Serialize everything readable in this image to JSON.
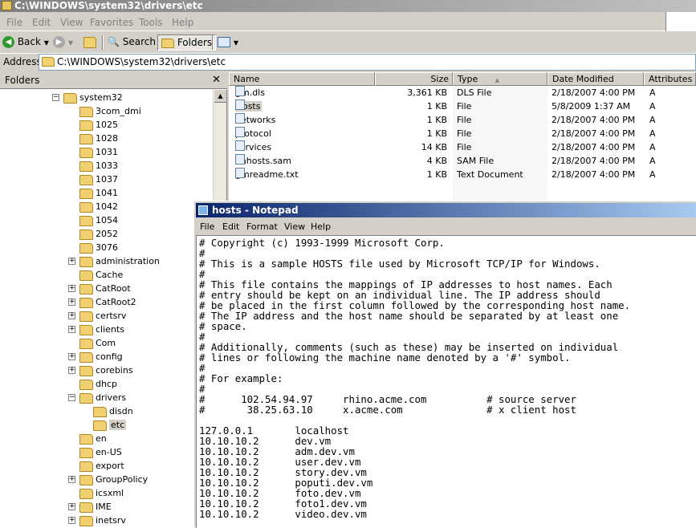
{
  "explorer": {
    "title": "C:\\WINDOWS\\system32\\drivers\\etc",
    "menu": [
      "File",
      "Edit",
      "View",
      "Favorites",
      "Tools",
      "Help"
    ],
    "toolbar": {
      "back": "Back",
      "search": "Search",
      "folders": "Folders"
    },
    "address_label": "Address",
    "address_value": "C:\\WINDOWS\\system32\\drivers\\etc"
  },
  "folders_pane": {
    "title": "Folders",
    "close": "✕",
    "tree": [
      {
        "label": "system32",
        "indent": 0,
        "toggle": "−"
      },
      {
        "label": "3com_dmi",
        "indent": 1,
        "toggle": ""
      },
      {
        "label": "1025",
        "indent": 1,
        "toggle": ""
      },
      {
        "label": "1028",
        "indent": 1,
        "toggle": ""
      },
      {
        "label": "1031",
        "indent": 1,
        "toggle": ""
      },
      {
        "label": "1033",
        "indent": 1,
        "toggle": ""
      },
      {
        "label": "1037",
        "indent": 1,
        "toggle": ""
      },
      {
        "label": "1041",
        "indent": 1,
        "toggle": ""
      },
      {
        "label": "1042",
        "indent": 1,
        "toggle": ""
      },
      {
        "label": "1054",
        "indent": 1,
        "toggle": ""
      },
      {
        "label": "2052",
        "indent": 1,
        "toggle": ""
      },
      {
        "label": "3076",
        "indent": 1,
        "toggle": ""
      },
      {
        "label": "administration",
        "indent": 1,
        "toggle": "+"
      },
      {
        "label": "Cache",
        "indent": 1,
        "toggle": ""
      },
      {
        "label": "CatRoot",
        "indent": 1,
        "toggle": "+"
      },
      {
        "label": "CatRoot2",
        "indent": 1,
        "toggle": "+"
      },
      {
        "label": "certsrv",
        "indent": 1,
        "toggle": "+"
      },
      {
        "label": "clients",
        "indent": 1,
        "toggle": "+"
      },
      {
        "label": "Com",
        "indent": 1,
        "toggle": ""
      },
      {
        "label": "config",
        "indent": 1,
        "toggle": "+"
      },
      {
        "label": "corebins",
        "indent": 1,
        "toggle": "+"
      },
      {
        "label": "dhcp",
        "indent": 1,
        "toggle": ""
      },
      {
        "label": "drivers",
        "indent": 1,
        "toggle": "−"
      },
      {
        "label": "disdn",
        "indent": 2,
        "toggle": ""
      },
      {
        "label": "etc",
        "indent": 2,
        "toggle": "",
        "selected": true
      },
      {
        "label": "en",
        "indent": 1,
        "toggle": ""
      },
      {
        "label": "en-US",
        "indent": 1,
        "toggle": ""
      },
      {
        "label": "export",
        "indent": 1,
        "toggle": ""
      },
      {
        "label": "GroupPolicy",
        "indent": 1,
        "toggle": "+"
      },
      {
        "label": "icsxml",
        "indent": 1,
        "toggle": ""
      },
      {
        "label": "IME",
        "indent": 1,
        "toggle": "+"
      },
      {
        "label": "inetsrv",
        "indent": 1,
        "toggle": "+"
      }
    ]
  },
  "file_list": {
    "columns": [
      "Name",
      "Size",
      "Type",
      "Date Modified",
      "Attributes"
    ],
    "files": [
      {
        "name": "gm.dls",
        "size": "3,361 KB",
        "type": "DLS File",
        "date": "2/18/2007 4:00 PM",
        "attr": "A"
      },
      {
        "name": "hosts",
        "size": "1 KB",
        "type": "File",
        "date": "5/8/2009 1:37 AM",
        "attr": "A",
        "selected": true
      },
      {
        "name": "networks",
        "size": "1 KB",
        "type": "File",
        "date": "2/18/2007 4:00 PM",
        "attr": "A"
      },
      {
        "name": "protocol",
        "size": "1 KB",
        "type": "File",
        "date": "2/18/2007 4:00 PM",
        "attr": "A"
      },
      {
        "name": "services",
        "size": "14 KB",
        "type": "File",
        "date": "2/18/2007 4:00 PM",
        "attr": "A"
      },
      {
        "name": "lmhosts.sam",
        "size": "4 KB",
        "type": "SAM File",
        "date": "2/18/2007 4:00 PM",
        "attr": "A"
      },
      {
        "name": "gmreadme.txt",
        "size": "1 KB",
        "type": "Text Document",
        "date": "2/18/2007 4:00 PM",
        "attr": "A"
      }
    ]
  },
  "notepad": {
    "title": "hosts - Notepad",
    "menu": [
      "File",
      "Edit",
      "Format",
      "View",
      "Help"
    ],
    "lines": [
      "# Copyright (c) 1993-1999 Microsoft Corp.",
      "#",
      "# This is a sample HOSTS file used by Microsoft TCP/IP for Windows.",
      "#",
      "# This file contains the mappings of IP addresses to host names. Each",
      "# entry should be kept on an individual line. The IP address should",
      "# be placed in the first column followed by the corresponding host name.",
      "# The IP address and the host name should be separated by at least one",
      "# space.",
      "#",
      "# Additionally, comments (such as these) may be inserted on individual",
      "# lines or following the machine name denoted by a '#' symbol.",
      "#",
      "# For example:",
      "#",
      "#      102.54.94.97     rhino.acme.com          # source server",
      "#       38.25.63.10     x.acme.com              # x client host",
      "",
      "127.0.0.1       localhost",
      "10.10.10.2      dev.vm",
      "10.10.10.2      adm.dev.vm",
      "10.10.10.2      user.dev.vm",
      "10.10.10.2      story.dev.vm",
      "10.10.10.2      poputi.dev.vm",
      "10.10.10.2      foto.dev.vm",
      "10.10.10.2      foto1.dev.vm",
      "10.10.10.2      video.dev.vm"
    ]
  }
}
